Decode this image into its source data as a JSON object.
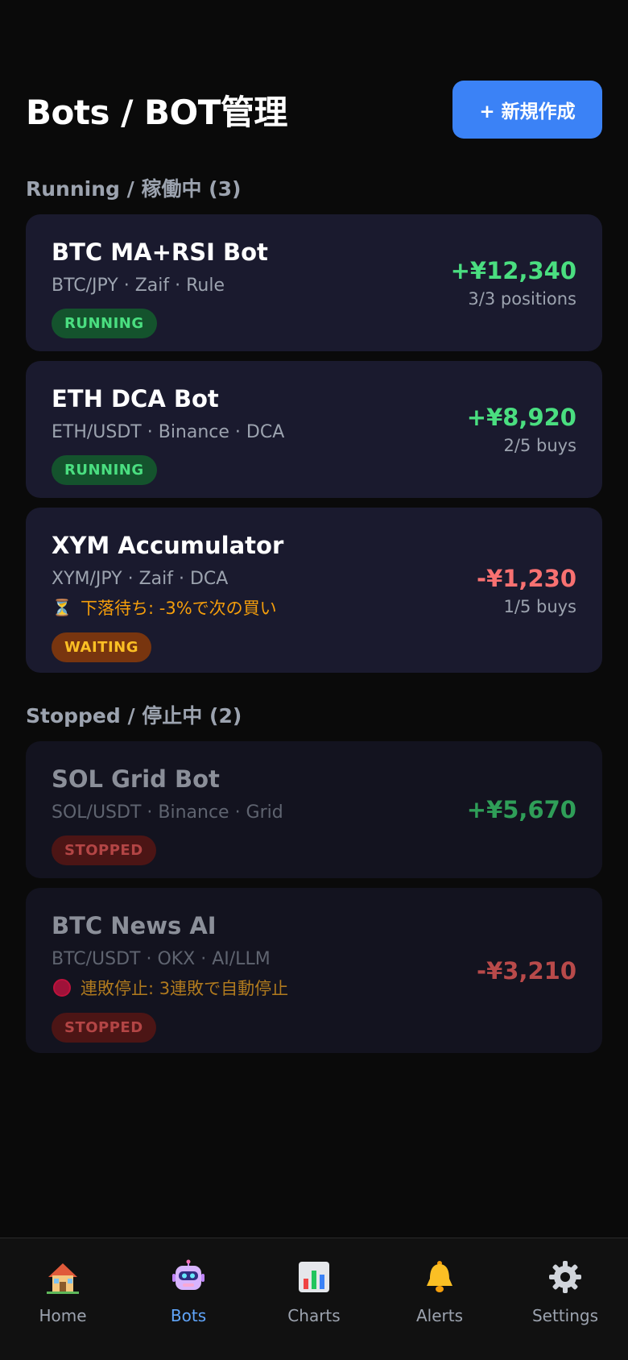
{
  "header": {
    "title": "Bots / BOT管理",
    "new_button_label": "+ 新規作成"
  },
  "sections": {
    "running_title": "Running / 稼働中 (3)",
    "stopped_title": "Stopped / 停止中 (2)"
  },
  "bots": [
    {
      "name": "BTC MA+RSI Bot",
      "meta": "BTC/JPY · Zaif · Rule",
      "status": "RUNNING",
      "pnl": "+¥12,340",
      "sub": "3/3 positions"
    },
    {
      "name": "ETH DCA Bot",
      "meta": "ETH/USDT · Binance · DCA",
      "status": "RUNNING",
      "pnl": "+¥8,920",
      "sub": "2/5 buys"
    },
    {
      "name": "XYM Accumulator",
      "meta": "XYM/JPY · Zaif · DCA",
      "note": "下落待ち: -3%で次の買い",
      "note_icon": "hourglass-icon",
      "status": "WAITING",
      "pnl": "-¥1,230",
      "sub": "1/5 buys"
    },
    {
      "name": "SOL Grid Bot",
      "meta": "SOL/USDT · Binance · Grid",
      "status": "STOPPED",
      "pnl": "+¥5,670"
    },
    {
      "name": "BTC News AI",
      "meta": "BTC/USDT · OKX · AI/LLM",
      "note": "連敗停止: 3連敗で自動停止",
      "note_icon": "stop-icon",
      "status": "STOPPED",
      "pnl": "-¥3,210"
    }
  ],
  "nav": [
    {
      "label": "Home",
      "icon": "home-icon"
    },
    {
      "label": "Bots",
      "icon": "robot-icon",
      "active": true
    },
    {
      "label": "Charts",
      "icon": "chart-icon"
    },
    {
      "label": "Alerts",
      "icon": "bell-icon"
    },
    {
      "label": "Settings",
      "icon": "gear-icon"
    }
  ],
  "colors": {
    "accent": "#3b82f6",
    "positive": "#4ade80",
    "negative": "#f87171",
    "waiting": "#fbbf24"
  }
}
